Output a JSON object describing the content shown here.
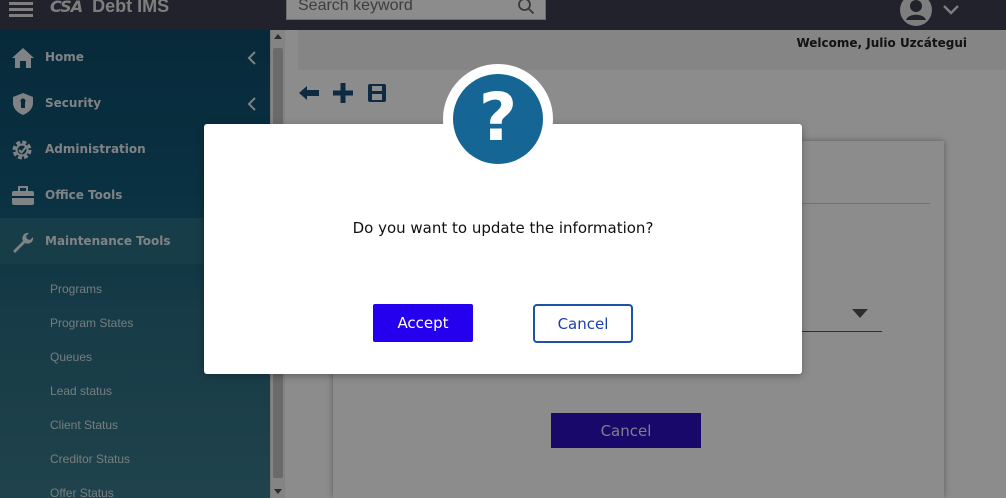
{
  "app": {
    "logo_mark": "CSA",
    "name": "Debt IMS"
  },
  "search": {
    "placeholder": "Search keyword",
    "value": ""
  },
  "header": {
    "welcome": "Welcome, Julio Uzcátegui"
  },
  "sidebar": {
    "items": [
      {
        "label": "Home",
        "icon": "home-icon"
      },
      {
        "label": "Security",
        "icon": "shield-icon"
      },
      {
        "label": "Administration",
        "icon": "gear-icon"
      },
      {
        "label": "Office Tools",
        "icon": "briefcase-icon"
      },
      {
        "label": "Maintenance Tools",
        "icon": "wrench-icon"
      }
    ],
    "sub_items": [
      "Programs",
      "Program States",
      "Queues",
      "Lead status",
      "Client Status",
      "Creditor Status",
      "Offer Status"
    ]
  },
  "toolbar": {
    "icons": [
      "back-arrow-icon",
      "add-icon",
      "save-icon"
    ]
  },
  "form": {
    "cancel_label": "Cancel"
  },
  "modal": {
    "icon": "question-icon",
    "message": "Do you want to update the information?",
    "accept_label": "Accept",
    "cancel_label": "Cancel"
  },
  "colors": {
    "topbar": "#3c3f50",
    "sidebar": "#0e4d6b",
    "accent": "#2500ee",
    "modal_icon": "#156694"
  }
}
